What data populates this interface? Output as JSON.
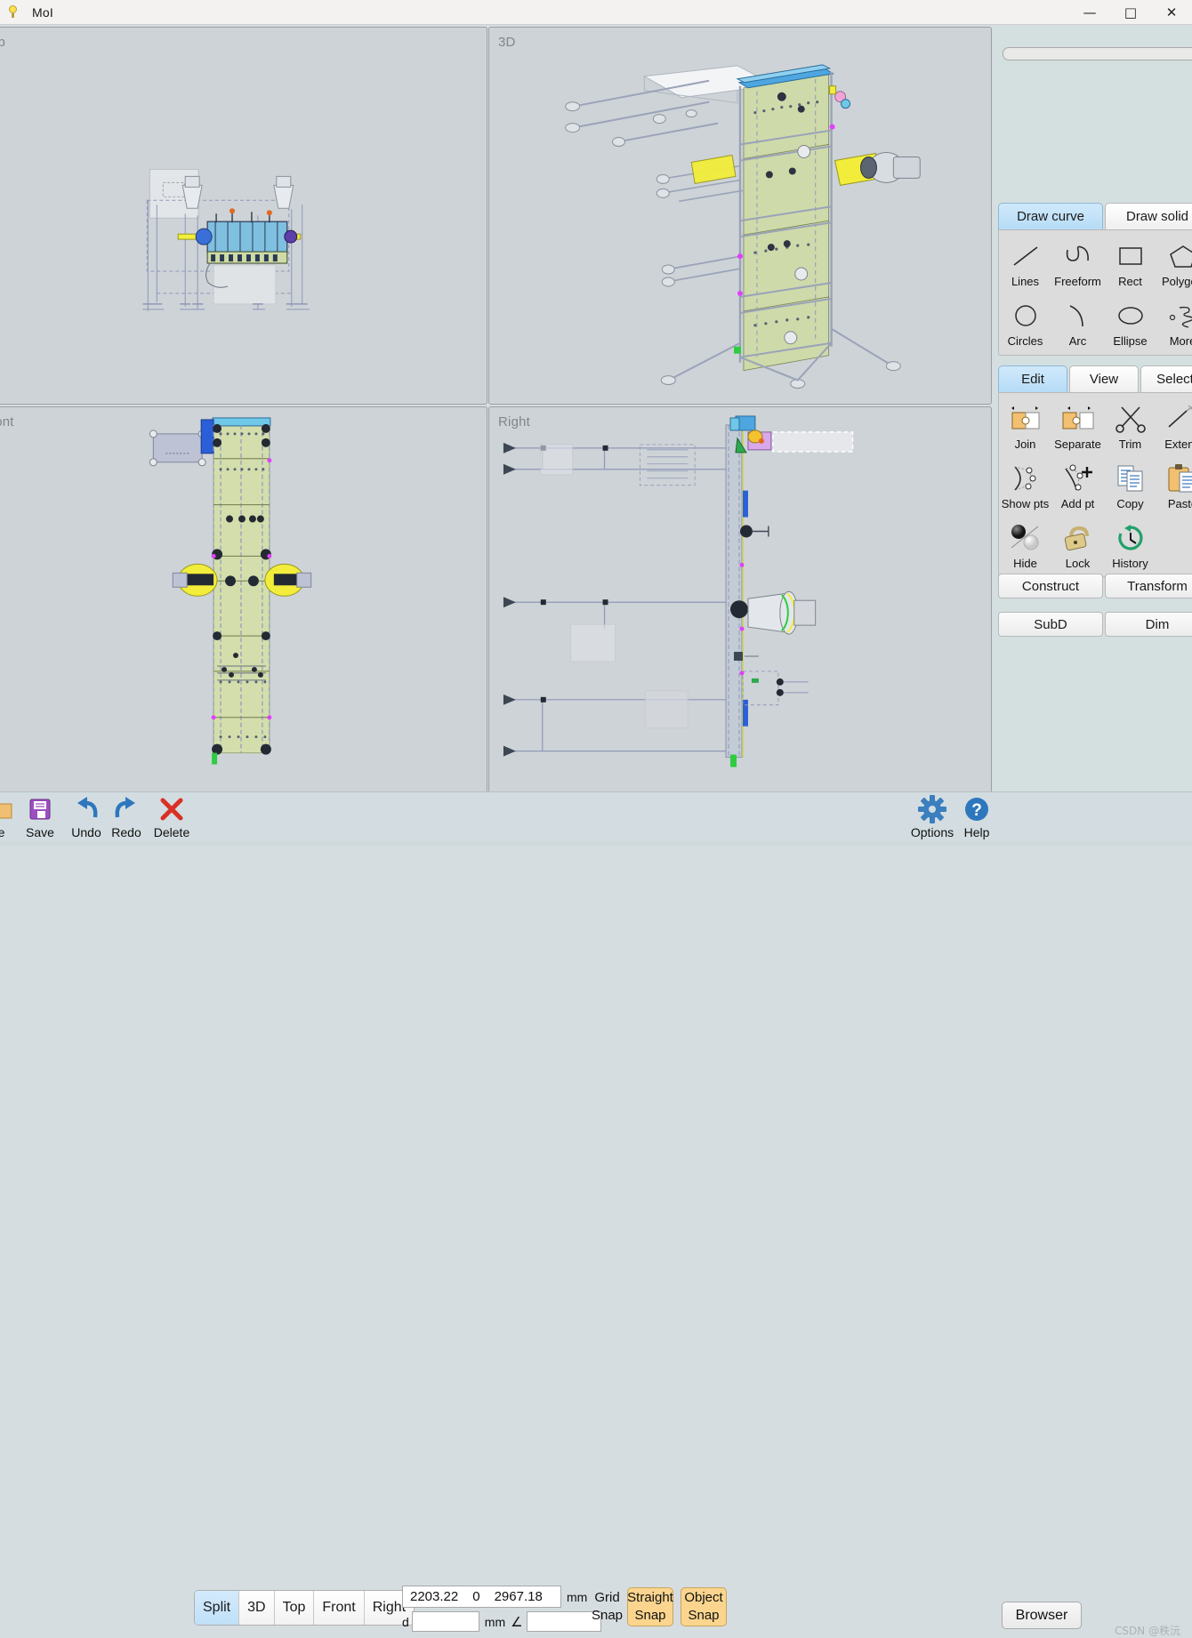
{
  "window": {
    "title": "MoI",
    "app_icon": "lightbulb-icon",
    "controls": {
      "minimize": "—",
      "maximize": "□",
      "close": "✕"
    }
  },
  "viewports": [
    {
      "id": "top",
      "label": "Top",
      "label_visible": "op",
      "clipped": true
    },
    {
      "id": "3d",
      "label": "3D",
      "label_visible": "3D",
      "clipped": false
    },
    {
      "id": "front",
      "label": "Front",
      "label_visible": "ront",
      "clipped": true
    },
    {
      "id": "right",
      "label": "Right",
      "label_visible": "Right",
      "clipped": false
    }
  ],
  "side_panel": {
    "draw_tabs": [
      {
        "label": "Draw curve",
        "active": true
      },
      {
        "label": "Draw solid",
        "active": false
      }
    ],
    "draw_tools": [
      {
        "label": "Lines",
        "icon": "line-icon"
      },
      {
        "label": "Freeform",
        "icon": "freeform-curve-icon"
      },
      {
        "label": "Rect",
        "icon": "rectangle-icon"
      },
      {
        "label": "Polygon",
        "icon": "polygon-icon"
      },
      {
        "label": "Circles",
        "icon": "circle-icon"
      },
      {
        "label": "Arc",
        "icon": "arc-icon"
      },
      {
        "label": "Ellipse",
        "icon": "ellipse-icon"
      },
      {
        "label": "More",
        "icon": "more-curves-icon"
      }
    ],
    "edit_tabs": [
      {
        "label": "Edit",
        "active": true
      },
      {
        "label": "View",
        "active": false
      },
      {
        "label": "Select",
        "active": false
      }
    ],
    "edit_tools": [
      {
        "label": "Join",
        "icon": "join-icon"
      },
      {
        "label": "Separate",
        "icon": "separate-icon"
      },
      {
        "label": "Trim",
        "icon": "scissors-icon"
      },
      {
        "label": "Extend",
        "icon": "extend-icon"
      },
      {
        "label": "Show pts",
        "icon": "show-points-icon"
      },
      {
        "label": "Add pt",
        "icon": "add-point-icon"
      },
      {
        "label": "Copy",
        "icon": "copy-icon"
      },
      {
        "label": "Paste",
        "icon": "paste-icon"
      },
      {
        "label": "Hide",
        "icon": "hide-sphere-icon"
      },
      {
        "label": "Lock",
        "icon": "padlock-icon"
      },
      {
        "label": "History",
        "icon": "history-clock-icon"
      }
    ],
    "construct_tabs": [
      {
        "label": "Construct",
        "active": false
      },
      {
        "label": "Transform",
        "active": false
      }
    ],
    "subd_tabs": [
      {
        "label": "SubD",
        "active": false
      },
      {
        "label": "Dim",
        "active": false
      }
    ]
  },
  "bottom_bar": {
    "file_button": {
      "label": "File",
      "label_visible": "le",
      "icon": "folder-icon"
    },
    "actions": [
      {
        "label": "Save",
        "icon": "floppy-disk-icon"
      },
      {
        "label": "Undo",
        "icon": "undo-arrow-icon"
      },
      {
        "label": "Redo",
        "icon": "redo-arrow-icon"
      },
      {
        "label": "Delete",
        "icon": "delete-x-icon"
      }
    ],
    "view_buttons": [
      {
        "label": "Split",
        "active": true
      },
      {
        "label": "3D",
        "active": false
      },
      {
        "label": "Top",
        "active": false
      },
      {
        "label": "Front",
        "active": false
      },
      {
        "label": "Right",
        "active": false
      }
    ],
    "coordinates": {
      "x": "2203.22",
      "y": "0",
      "z": "2967.18",
      "unit": "mm",
      "distance_label": "d",
      "distance_value": "",
      "distance_unit": "mm",
      "angle_symbol": "∠",
      "angle_value": ""
    },
    "snaps": [
      {
        "label_line1": "Grid",
        "label_line2": "Snap",
        "active": false,
        "name": "grid-snap"
      },
      {
        "label_line1": "Straight",
        "label_line2": "Snap",
        "active": true,
        "name": "straight-snap"
      },
      {
        "label_line1": "Object",
        "label_line2": "Snap",
        "active": true,
        "name": "object-snap"
      }
    ],
    "right_actions": [
      {
        "label": "Options",
        "icon": "gear-icon"
      },
      {
        "label": "Help",
        "icon": "help-question-icon"
      }
    ],
    "browser_button": "Browser",
    "watermark": "CSDN @秩沅"
  },
  "colors": {
    "accent_tab": "#b6dcf7",
    "snap_active": "#fbd58e",
    "viewport_bg": "#ced3d7",
    "panel_bg": "#d4dfe0",
    "toolbar_bg": "#d3dde1",
    "model_green": "#cfdba6",
    "model_blue": "#7fbfe0",
    "model_yellow": "#f2ed3a"
  }
}
